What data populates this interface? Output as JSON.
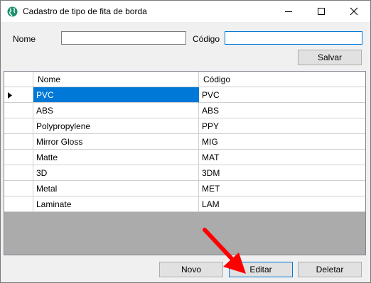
{
  "window": {
    "title": "Cadastro de tipo de fita de borda",
    "app_icon": "globe-icon",
    "controls": {
      "minimize": "minimize-icon",
      "maximize": "maximize-icon",
      "close": "close-icon"
    }
  },
  "form": {
    "name_label": "Nome",
    "name_value": "",
    "code_label": "Código",
    "code_value": "",
    "save_label": "Salvar"
  },
  "grid": {
    "columns": [
      "Nome",
      "Código"
    ],
    "selected_index": 0,
    "rows": [
      {
        "name": "PVC",
        "code": "PVC"
      },
      {
        "name": "ABS",
        "code": "ABS"
      },
      {
        "name": "Polypropylene",
        "code": "PPY"
      },
      {
        "name": "Mirror Gloss",
        "code": "MIG"
      },
      {
        "name": "Matte",
        "code": "MAT"
      },
      {
        "name": "3D",
        "code": "3DM"
      },
      {
        "name": "Metal",
        "code": "MET"
      },
      {
        "name": "Laminate",
        "code": "LAM"
      }
    ]
  },
  "actions": {
    "new_label": "Novo",
    "edit_label": "Editar",
    "delete_label": "Deletar"
  },
  "colors": {
    "selection": "#0078d7",
    "annotation_arrow": "#ff0000",
    "empty_grid_area": "#ababab"
  }
}
